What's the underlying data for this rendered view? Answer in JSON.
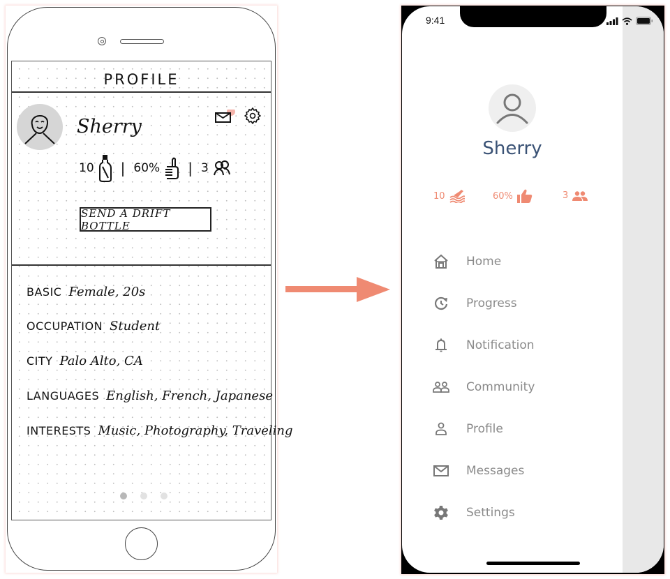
{
  "sketch": {
    "title": "PROFILE",
    "user_name": "Sherry",
    "stats": {
      "bottles": "10",
      "likes": "60%",
      "friends": "3",
      "separator": "|"
    },
    "icons": {
      "avatar": "smiley-face-icon",
      "mail": "envelope-icon",
      "settings": "gear-icon",
      "bottles": "bottle-icon",
      "likes": "thumbs-up-icon",
      "friends": "people-icon"
    },
    "mail_badge_color": "#f4b3aa",
    "action_button": "SEND A DRIFT BOTTLE",
    "info": [
      {
        "key": "BASIC",
        "value": "Female, 20s"
      },
      {
        "key": "OCCUPATION",
        "value": "Student"
      },
      {
        "key": "CITY",
        "value": "Palo Alto, CA"
      },
      {
        "key": "LANGUAGES",
        "value": "English, French, Japanese"
      },
      {
        "key": "INTERESTS",
        "value": "Music, Photography, Traveling"
      }
    ],
    "page_dots": {
      "count": 3,
      "active": 1
    }
  },
  "arrow": {
    "color": "#ef8a72",
    "direction": "right"
  },
  "hifi": {
    "status_bar": {
      "time": "9:41",
      "icons": [
        "signal-icon",
        "wifi-icon",
        "battery-icon"
      ]
    },
    "user_name": "Sherry",
    "stats": [
      {
        "value": "10",
        "icon": "drift-bottle-icon"
      },
      {
        "value": "60%",
        "icon": "thumbs-up-icon"
      },
      {
        "value": "3",
        "icon": "people-icon"
      }
    ],
    "accent_color": "#ef8a72",
    "name_color": "#3a5275",
    "menu": [
      {
        "label": "Home",
        "icon": "home-icon"
      },
      {
        "label": "Progress",
        "icon": "progress-icon"
      },
      {
        "label": "Notification",
        "icon": "bell-icon"
      },
      {
        "label": "Community",
        "icon": "community-icon"
      },
      {
        "label": "Profile",
        "icon": "person-icon"
      },
      {
        "label": "Messages",
        "icon": "mail-icon"
      },
      {
        "label": "Settings",
        "icon": "gear-icon"
      }
    ]
  }
}
